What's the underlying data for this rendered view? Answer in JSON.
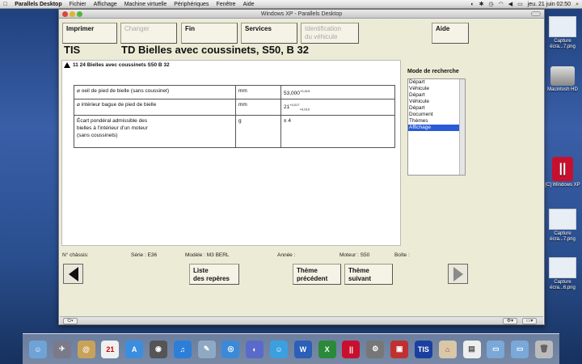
{
  "menubar": {
    "apple": "",
    "items": [
      "Parallels Desktop",
      "Fichier",
      "Affichage",
      "Machine virtuelle",
      "Périphériques",
      "Fenêtre",
      "Aide"
    ],
    "clock": "jeu. 21 juin  02:50"
  },
  "desktop": {
    "icons": [
      {
        "label": "Capture écra...7.png"
      },
      {
        "label": "Macintosh HD"
      },
      {
        "label": "[C] Windows XP"
      },
      {
        "label": "Capture écra...7.png"
      },
      {
        "label": "Capture écra...6.png"
      }
    ]
  },
  "window": {
    "title": "Windows XP - Parallels Desktop"
  },
  "toolbar": {
    "imprimer": "Imprimer",
    "changer": "Changer",
    "fin": "Fin",
    "services": "Services",
    "identification_line1": "Identification",
    "identification_line2": "du véhicule",
    "aide": "Aide"
  },
  "app": {
    "name": "TIS",
    "doc_title": "TD  Bielles avec coussinets, S50, B 32"
  },
  "section": {
    "heading": "11 24 Bielles avec coussinets S50  B 32"
  },
  "spec_rows": [
    {
      "desc": [
        "⌀ oeil de pied de bielle (sans coussinet)"
      ],
      "unit": "mm",
      "value": "53,000",
      "tol_top": "+0,019",
      "tol_bottom": ""
    },
    {
      "desc": [
        "⌀ intérieur bague de pied de bielle"
      ],
      "unit": "mm",
      "value": "21",
      "tol_top": "+0,017",
      "tol_bottom": "+0,010"
    },
    {
      "desc": [
        "Écart pondéral admissible des",
        "bielles à l'intérieur d'un moteur",
        "(sans coussinets)"
      ],
      "unit": "g",
      "value": "± 4",
      "tol_top": "",
      "tol_bottom": ""
    }
  ],
  "search": {
    "label": "Mode de recherche",
    "items": [
      "Départ",
      "Véhicule",
      "Départ",
      "Véhicule",
      "Départ",
      "Document",
      "Thèmes",
      "Affichage"
    ],
    "selected_index": 7
  },
  "info": {
    "chassis": "N° châssis:",
    "serie": "Série : E36",
    "modele": "Modèle : M3 BERL",
    "annee": "Année :",
    "moteur": "Moteur : S50",
    "boite": "Boîte :"
  },
  "nav": {
    "liste_line1": "Liste",
    "liste_line2": "des repères",
    "prec_line1": "Thème",
    "prec_line2": "précédent",
    "suiv_line1": "Thème",
    "suiv_line2": "suivant"
  },
  "dock": {
    "tis_label": "TIS",
    "calendar_day": "21"
  }
}
